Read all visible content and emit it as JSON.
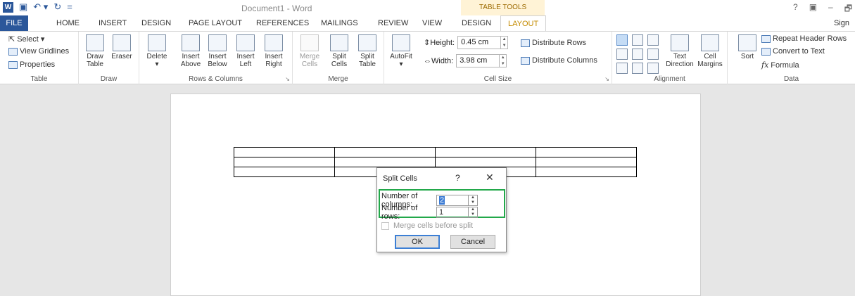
{
  "titlebar": {
    "qat": {
      "logo": "W",
      "save_icon": "save-icon",
      "undo_icon": "undo-icon",
      "redo_icon": "redo-icon",
      "customize": "="
    },
    "doc_title": "Document1 - Word",
    "context_tab_group": "TABLE TOOLS",
    "window_controls": [
      "?",
      "▣",
      "–",
      "🗗"
    ]
  },
  "tabs": {
    "file": "FILE",
    "home": "HOME",
    "insert": "INSERT",
    "design": "DESIGN",
    "page_layout": "PAGE LAYOUT",
    "references": "REFERENCES",
    "mailings": "MAILINGS",
    "review": "REVIEW",
    "view": "VIEW",
    "design_tt": "DESIGN",
    "layout_tt": "LAYOUT",
    "sign": "Sign"
  },
  "ribbon": {
    "table": {
      "label": "Table",
      "select": "Select ▾",
      "view_gridlines": "View Gridlines",
      "properties": "Properties"
    },
    "draw": {
      "label": "Draw",
      "draw_table": "Draw Table",
      "eraser": "Eraser"
    },
    "rows_columns": {
      "label": "Rows & Columns",
      "delete": "Delete",
      "insert_above": "Insert Above",
      "insert_below": "Insert Below",
      "insert_left": "Insert Left",
      "insert_right": "Insert Right"
    },
    "merge": {
      "label": "Merge",
      "merge_cells": "Merge Cells",
      "split_cells": "Split Cells",
      "split_table": "Split Table"
    },
    "cell_size": {
      "label": "Cell Size",
      "autofit": "AutoFit",
      "height_label": "Height:",
      "height_value": "0.45 cm",
      "width_label": "Width:",
      "width_value": "3.98 cm",
      "distribute_rows": "Distribute Rows",
      "distribute_columns": "Distribute Columns"
    },
    "alignment": {
      "label": "Alignment",
      "text_direction": "Text Direction",
      "cell_margins": "Cell Margins"
    },
    "data": {
      "label": "Data",
      "sort": "Sort",
      "repeat_header_rows": "Repeat Header Rows",
      "convert_to_text": "Convert to Text",
      "formula": "Formula"
    }
  },
  "dialog": {
    "title": "Split Cells",
    "help": "?",
    "close": "✕",
    "columns_label": "Number of columns:",
    "columns_value": "2",
    "rows_label": "Number of rows:",
    "rows_value": "1",
    "merge_before_split": "Merge cells before split",
    "ok": "OK",
    "cancel": "Cancel",
    "highlight_color": "#22a84a"
  }
}
